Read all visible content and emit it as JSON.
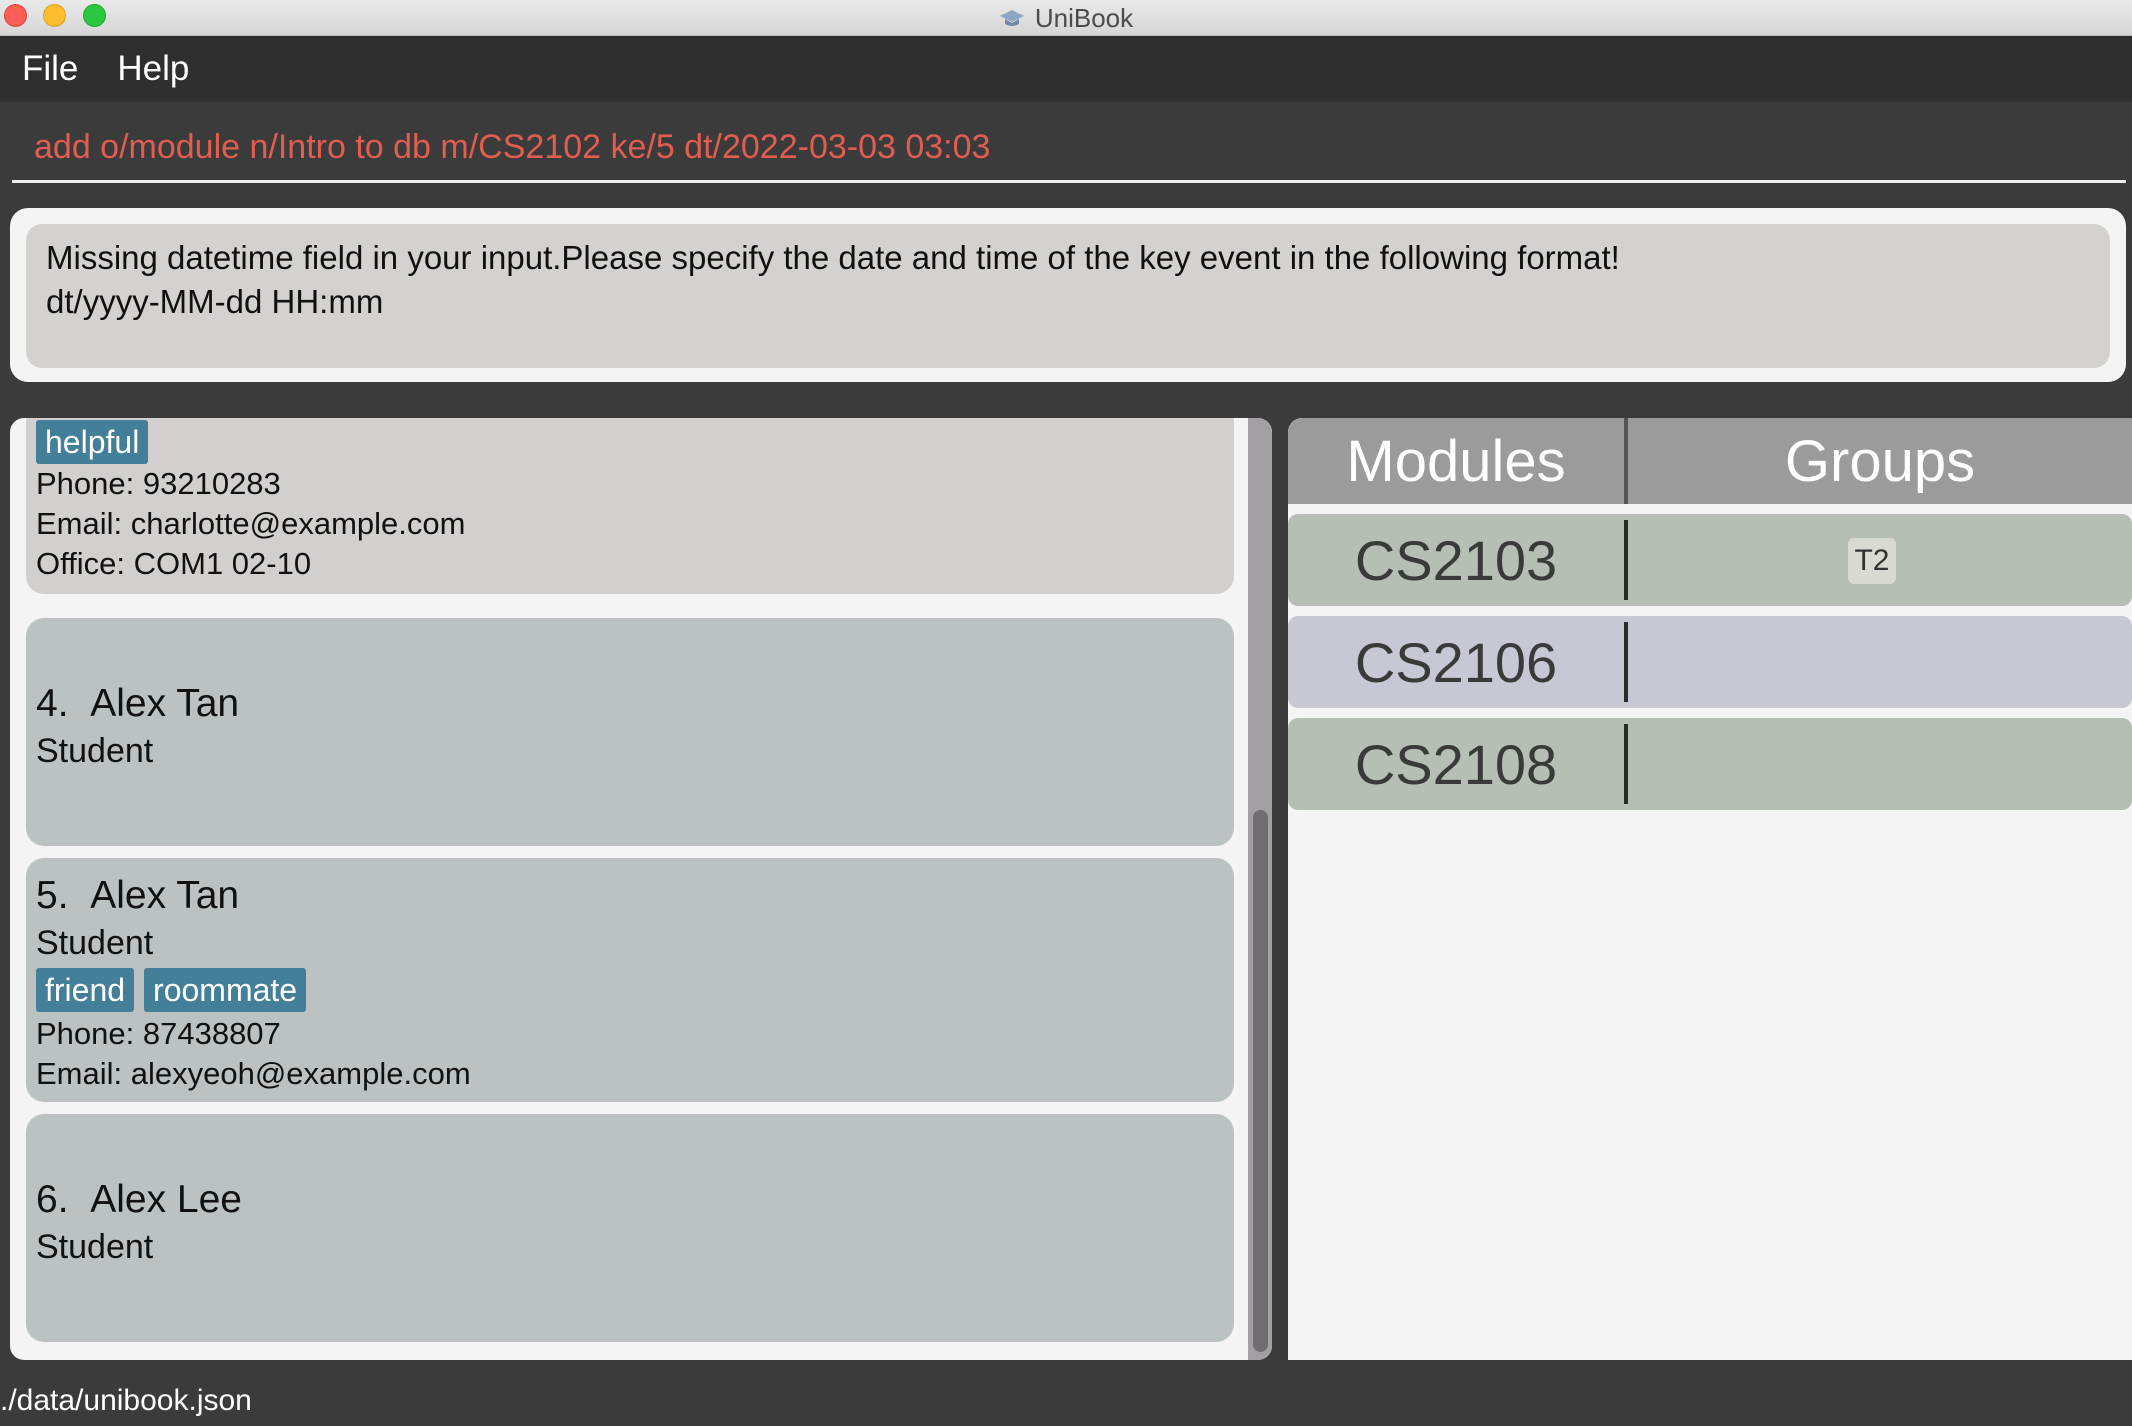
{
  "window": {
    "title": "UniBook"
  },
  "menu": {
    "file": "File",
    "help": "Help"
  },
  "command": {
    "value": "add o/module n/Intro to db m/CS2102 ke/5 dt/2022-03-03 03:03"
  },
  "result": {
    "line1": "Missing datetime field in your input.Please specify the date and time of the key event in the following format!",
    "line2": "dt/yyyy-MM-dd HH:mm"
  },
  "people": {
    "partial": {
      "tags": [
        "helpful"
      ],
      "phone": "Phone: 93210283",
      "email": "Email: charlotte@example.com",
      "office": "Office: COM1 02-10"
    },
    "cards": [
      {
        "index": "4.",
        "name": "Alex Tan",
        "role": "Student"
      },
      {
        "index": "5.",
        "name": "Alex Tan",
        "role": "Student",
        "tags": [
          "friend",
          "roommate"
        ],
        "phone": "Phone: 87438807",
        "email": "Email: alexyeoh@example.com"
      },
      {
        "index": "6.",
        "name": "Alex Lee",
        "role": "Student"
      }
    ]
  },
  "modules": {
    "header_modules": "Modules",
    "header_groups": "Groups",
    "rows": [
      {
        "code": "CS2103",
        "groups": [
          "T2"
        ],
        "color": "#b6beb6"
      },
      {
        "code": "CS2106",
        "groups": [],
        "color": "#c8c8d4"
      },
      {
        "code": "CS2108",
        "groups": [],
        "color": "#b6beb6"
      }
    ]
  },
  "status": {
    "path": "./data/unibook.json"
  }
}
